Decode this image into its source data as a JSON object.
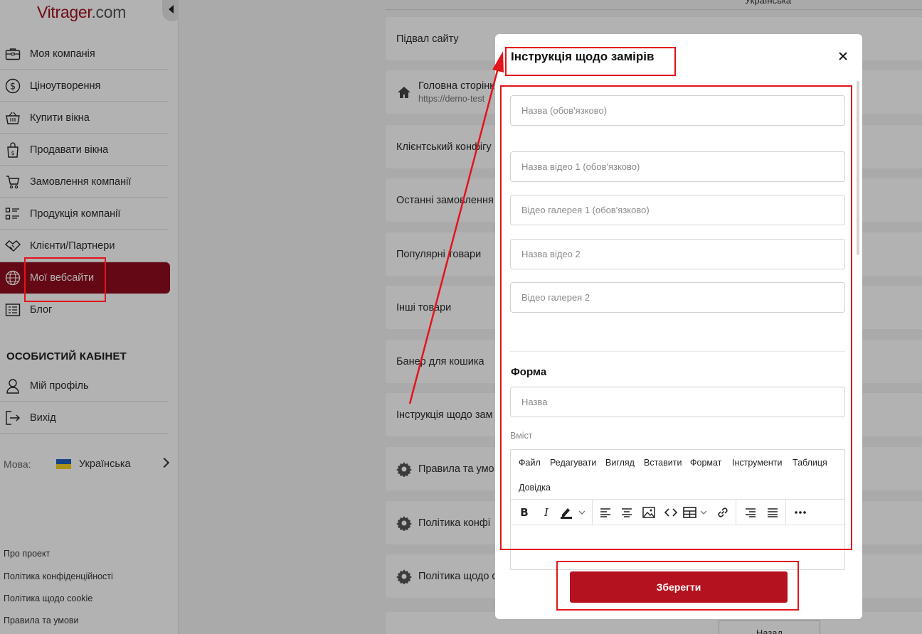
{
  "brand": {
    "name": "Vitrager",
    "suffix": ".com"
  },
  "sidebar": {
    "items": [
      {
        "label": "Моя компанія",
        "icon": "briefcase-icon"
      },
      {
        "label": "Ціноутворення",
        "icon": "dollar-circle-icon"
      },
      {
        "label": "Купити вікна",
        "icon": "basket-icon"
      },
      {
        "label": "Продавати вікна",
        "icon": "shopping-bag-icon"
      },
      {
        "label": "Замовлення компанії",
        "icon": "cart-icon"
      },
      {
        "label": "Продукція компанії",
        "icon": "list-grid-icon"
      },
      {
        "label": "Клієнти/Партнери",
        "icon": "handshake-icon"
      },
      {
        "label": "Мої вебсайти",
        "icon": "globe-icon",
        "active": true
      },
      {
        "label": "Блог",
        "icon": "news-icon"
      }
    ],
    "section_title": "ОСОБИСТИЙ КАБІНЕТ",
    "personal": [
      {
        "label": "Мій профіль",
        "icon": "user-icon"
      },
      {
        "label": "Вихід",
        "icon": "logout-icon"
      }
    ],
    "language": {
      "label": "Мова:",
      "value": "Українська"
    },
    "footer_links": [
      "Про проект",
      "Політика конфіденційності",
      "Політика щодо cookie",
      "Правила та умови"
    ]
  },
  "main": {
    "top_lang": "Українська",
    "cards": [
      {
        "label": "Підвал сайту"
      },
      {
        "label": "Головна сторінк",
        "sub": "https://demo-test",
        "icon": "home-icon"
      },
      {
        "label": "Клієнтський конфігу"
      },
      {
        "label": "Останні замовлення"
      },
      {
        "label": "Популярні товари"
      },
      {
        "label": "Інші товари"
      },
      {
        "label": "Банер для кошика"
      },
      {
        "label": "Інструкція щодо зам"
      },
      {
        "label": "Правила та умо",
        "icon": "gear-icon"
      },
      {
        "label": "Політика конфі",
        "icon": "gear-icon"
      },
      {
        "label": "Політика щодо с",
        "icon": "gear-icon"
      }
    ],
    "back_label": "Назад"
  },
  "modal": {
    "title": "Інструкція щодо замірів",
    "fields": [
      {
        "placeholder": "Назва (обов'язково)"
      },
      {
        "placeholder": "Назва відео 1 (обов'язково)"
      },
      {
        "placeholder": "Відео галерея 1 (обов'язково)"
      },
      {
        "placeholder": "Назва відео 2"
      },
      {
        "placeholder": "Відео галерея 2"
      }
    ],
    "form_title": "Форма",
    "form_name_placeholder": "Назва",
    "content_label": "Вміст",
    "editor": {
      "menu": [
        "Файл",
        "Редагувати",
        "Вигляд",
        "Вставити",
        "Формат",
        "Інструменти",
        "Таблиця",
        "Довідка"
      ]
    },
    "save_label": "Зберегти"
  },
  "colors": {
    "brand": "#a0101c",
    "active_nav": "#8e0c1e",
    "save_button": "#b5121f",
    "annotation": "#e3141b"
  }
}
